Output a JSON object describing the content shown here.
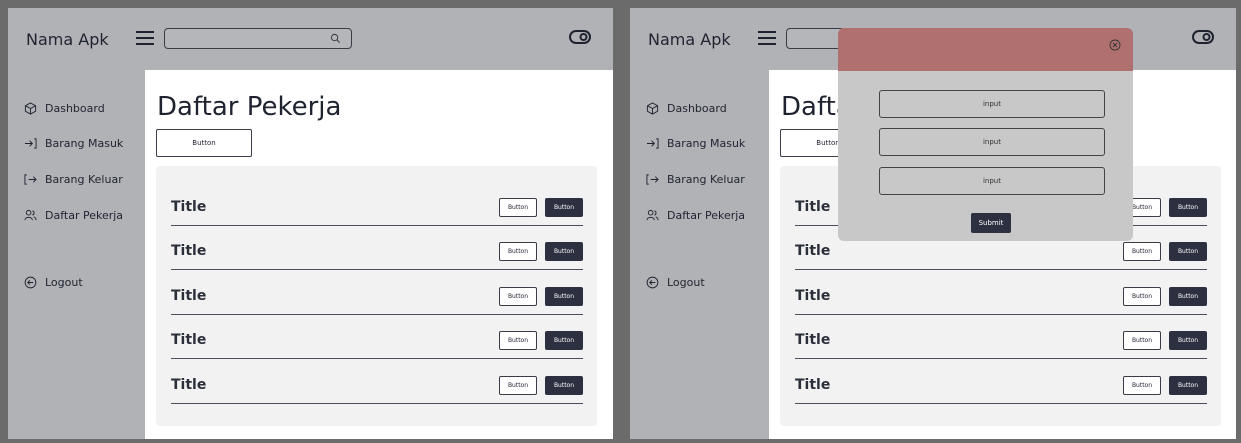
{
  "app": {
    "name": "Nama Apk"
  },
  "sidebar": {
    "items": [
      {
        "label": "Dashboard",
        "icon": "box-icon"
      },
      {
        "label": "Barang Masuk",
        "icon": "arrow-in-icon"
      },
      {
        "label": "Barang Keluar",
        "icon": "arrow-out-icon"
      },
      {
        "label": "Daftar Pekerja",
        "icon": "users-icon"
      }
    ],
    "logout": {
      "label": "Logout",
      "icon": "logout-circle-icon"
    }
  },
  "main": {
    "title": "Daftar Pekerja",
    "primary_button": "Button",
    "rows": [
      {
        "title": "Title",
        "button1": "Button",
        "button2": "Button"
      },
      {
        "title": "Title",
        "button1": "Button",
        "button2": "Button"
      },
      {
        "title": "Title",
        "button1": "Button",
        "button2": "Button"
      },
      {
        "title": "Title",
        "button1": "Button",
        "button2": "Button"
      },
      {
        "title": "Title",
        "button1": "Button",
        "button2": "Button"
      }
    ]
  },
  "modal": {
    "inputs": [
      "input",
      "input",
      "input"
    ],
    "submit": "Submit"
  },
  "colors": {
    "background": "#b0b2b5",
    "panel": "#ffffff",
    "dark_button": "#2c3040",
    "modal_header": "#b07070",
    "modal_body": "#c8c8c8"
  }
}
